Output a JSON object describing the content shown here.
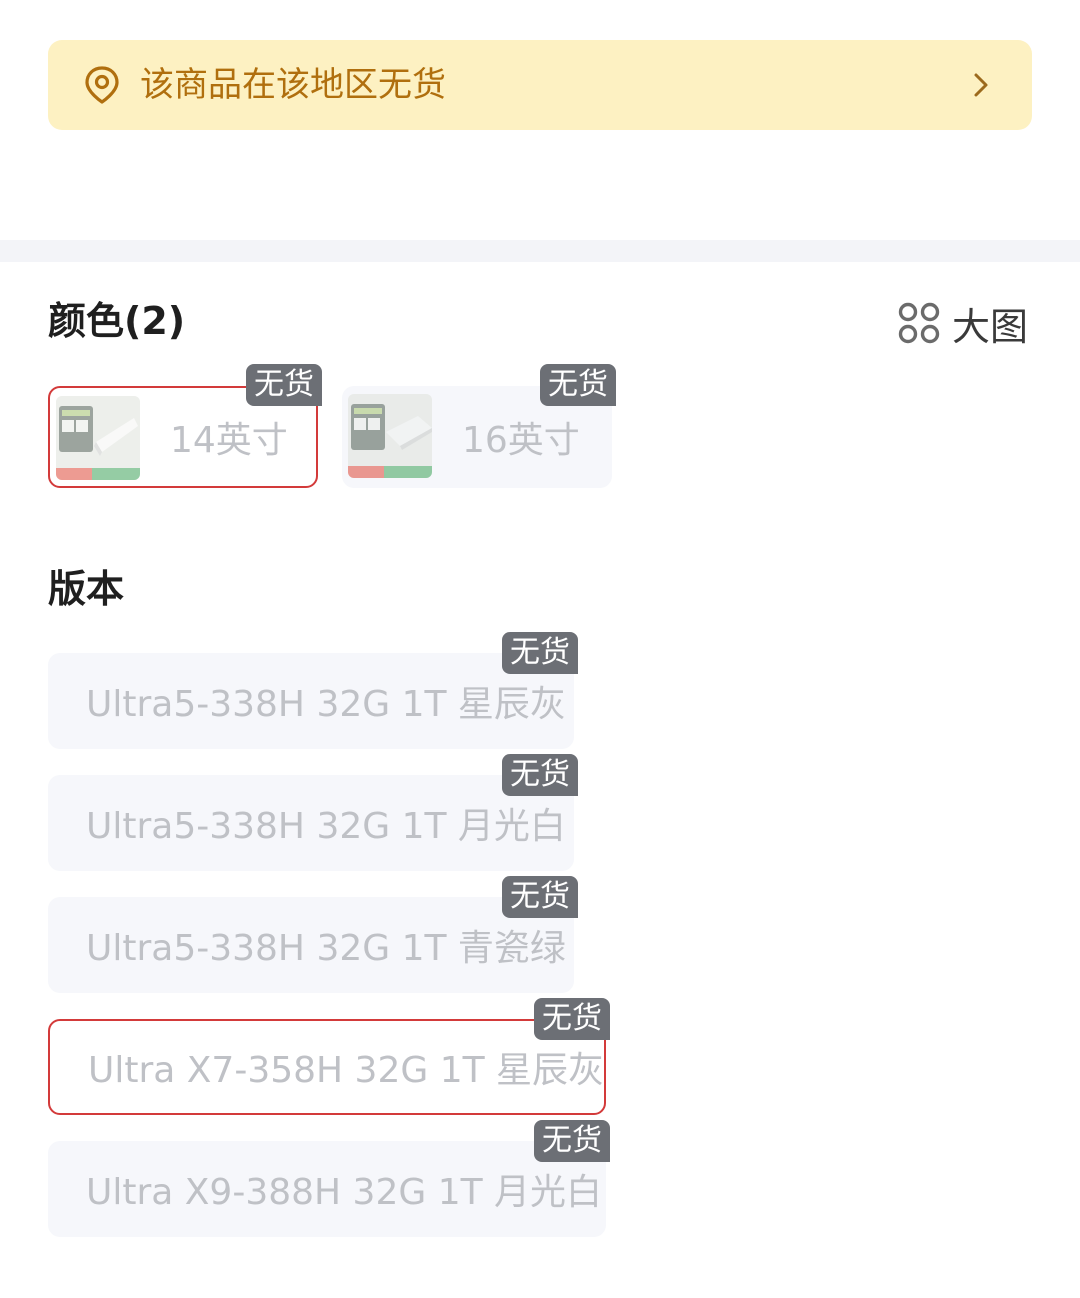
{
  "notice": {
    "text": "该商品在该地区无货",
    "icon": "location-pin-icon",
    "arrow_icon": "chevron-right-icon",
    "background": "#fdf1c2",
    "text_color": "#b06f0e"
  },
  "color_section": {
    "title": "颜色(2)",
    "bigview_label": "大图",
    "bigview_icon": "grid-four-circles-icon",
    "options": [
      {
        "label": "14英寸",
        "tag": "无货",
        "selected": true
      },
      {
        "label": "16英寸",
        "tag": "无货",
        "selected": false
      }
    ]
  },
  "version_section": {
    "title": "版本",
    "options": [
      {
        "label": "Ultra5-338H 32G 1T 星辰灰",
        "tag": "无货",
        "selected": false
      },
      {
        "label": "Ultra5-338H 32G 1T 月光白",
        "tag": "无货",
        "selected": false
      },
      {
        "label": "Ultra5-338H 32G 1T 青瓷绿",
        "tag": "无货",
        "selected": false
      },
      {
        "label": "Ultra X7-358H 32G 1T 星辰灰",
        "tag": "无货",
        "selected": true
      },
      {
        "label": "Ultra X9-388H 32G 1T 月光白",
        "tag": "无货",
        "selected": false
      }
    ]
  },
  "colors": {
    "selected_border": "#d33a3a",
    "tag_background": "#6c6f75",
    "disabled_text": "#bfc1c6"
  }
}
